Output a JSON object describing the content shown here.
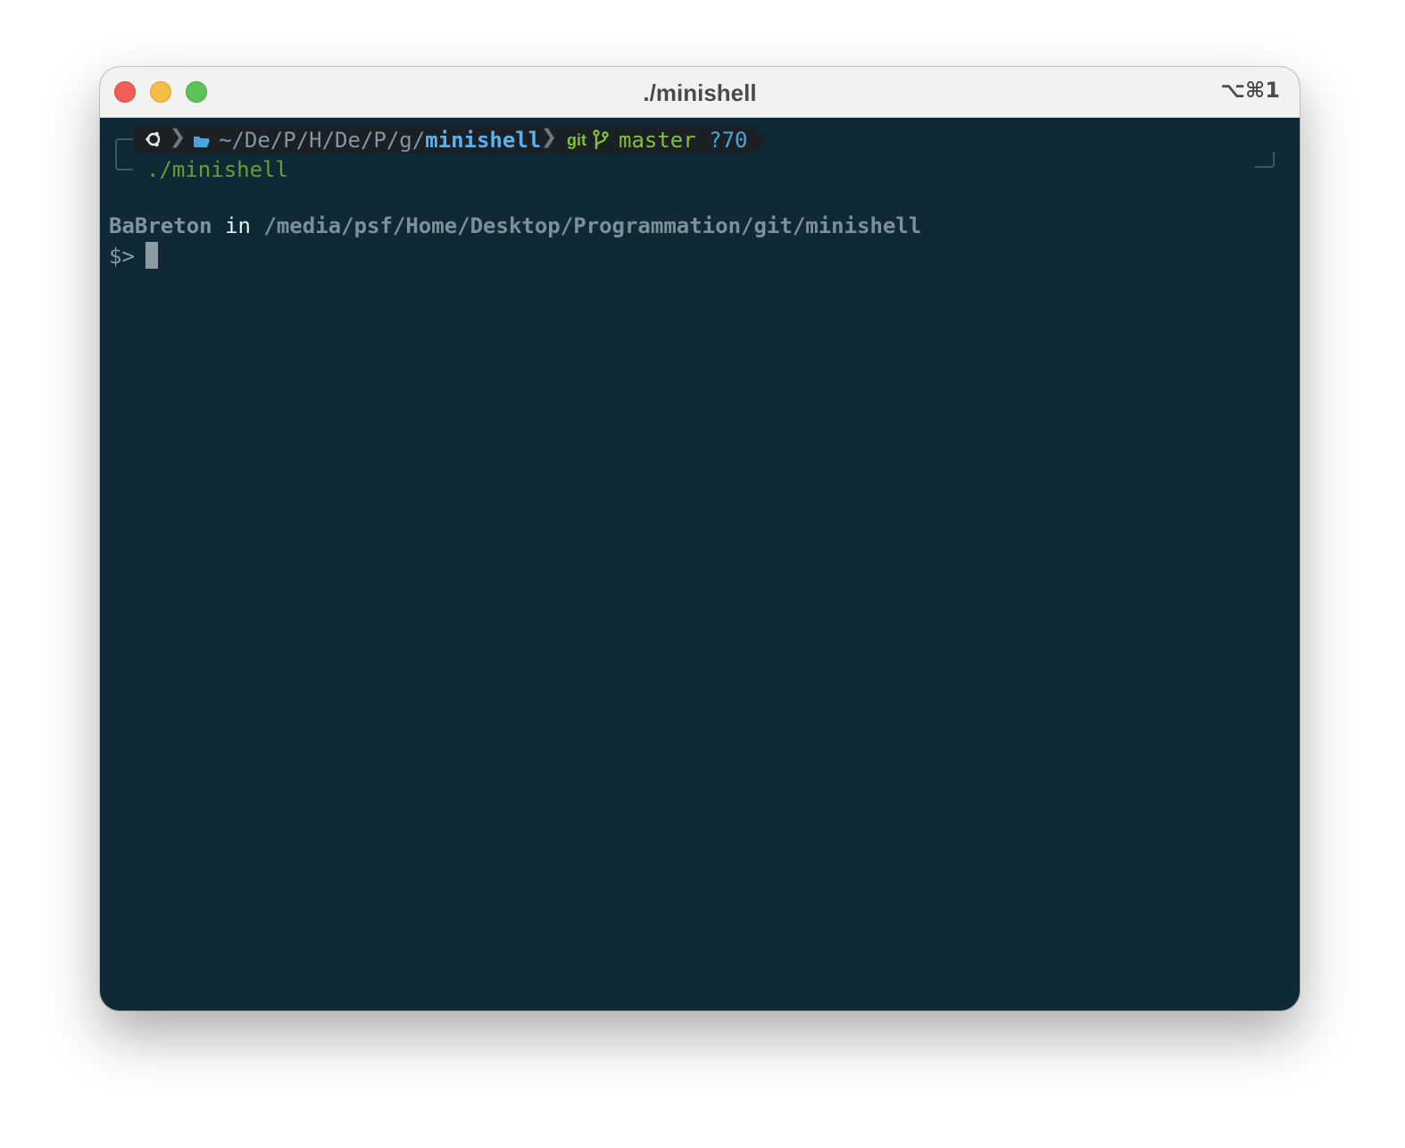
{
  "window": {
    "title": "./minishell",
    "shortcut": "⌥⌘1"
  },
  "powerline": {
    "os_icon": "ubuntu-icon",
    "folder_icon": "folder-icon",
    "path_prefix": "~/De/P/H/De/P/g/",
    "path_current": "minishell",
    "git_label": "git",
    "branch_icon": "git-branch-icon",
    "branch": "master",
    "untracked": "?70"
  },
  "terminal": {
    "command": "./minishell",
    "user": "BaBreton",
    "in_word": "in",
    "cwd": "/media/psf/Home/Desktop/Programmation/git/minishell",
    "prompt": "$>"
  },
  "colors": {
    "terminal_bg": "#0f2a36",
    "titlebar_bg": "#f2f2f1",
    "path_current": "#5bb1ee",
    "branch": "#7fc23b",
    "command": "#6a9d2e"
  }
}
